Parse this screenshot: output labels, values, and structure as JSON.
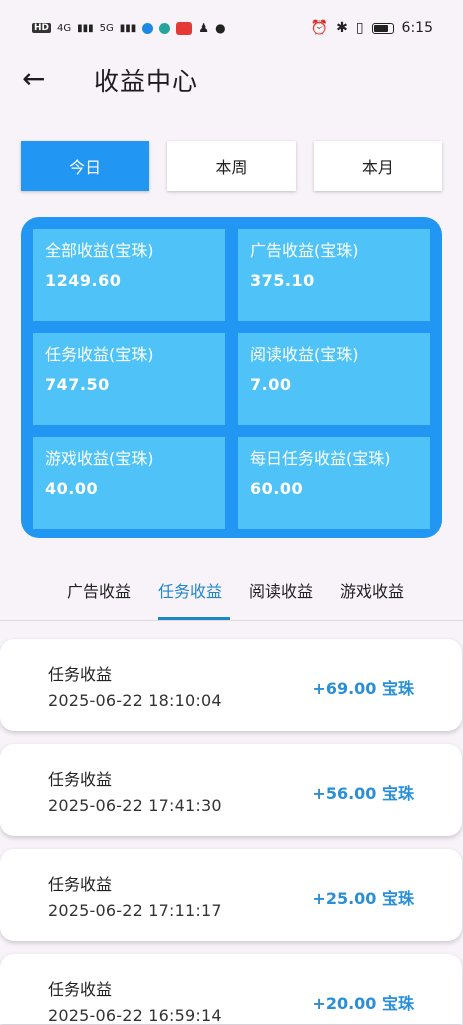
{
  "status_bar": {
    "hd_label": "HD",
    "net1": "4G",
    "net2": "5G",
    "time": "6:15",
    "icons": [
      "bell-icon",
      "bluetooth-icon",
      "vibrate-icon",
      "battery-icon"
    ]
  },
  "header": {
    "title": "收益中心",
    "back_icon": "arrow-left-icon"
  },
  "periods": [
    "今日",
    "本周",
    "本月"
  ],
  "active_period": "今日",
  "stats": [
    {
      "label": "全部收益(宝珠)",
      "value": "1249.60"
    },
    {
      "label": "广告收益(宝珠)",
      "value": "375.10"
    },
    {
      "label": "任务收益(宝珠)",
      "value": "747.50"
    },
    {
      "label": "阅读收益(宝珠)",
      "value": "7.00"
    },
    {
      "label": "游戏收益(宝珠)",
      "value": "40.00"
    },
    {
      "label": "每日任务收益(宝珠)",
      "value": "60.00"
    }
  ],
  "categories": [
    "广告收益",
    "任务收益",
    "阅读收益",
    "游戏收益"
  ],
  "active_category": "任务收益",
  "records": [
    {
      "title": "任务收益",
      "time": "2025-06-22 18:10:04",
      "amount": "+69.00 宝珠"
    },
    {
      "title": "任务收益",
      "time": "2025-06-22 17:41:30",
      "amount": "+56.00 宝珠"
    },
    {
      "title": "任务收益",
      "time": "2025-06-22 17:11:17",
      "amount": "+25.00 宝珠"
    },
    {
      "title": "任务收益",
      "time": "2025-06-22 16:59:14",
      "amount": "+20.00 宝珠"
    }
  ],
  "colors": {
    "primary": "#2196f3",
    "tile": "#4fc3f7",
    "accent": "#1f86c8",
    "background": "#f8f2f9"
  }
}
